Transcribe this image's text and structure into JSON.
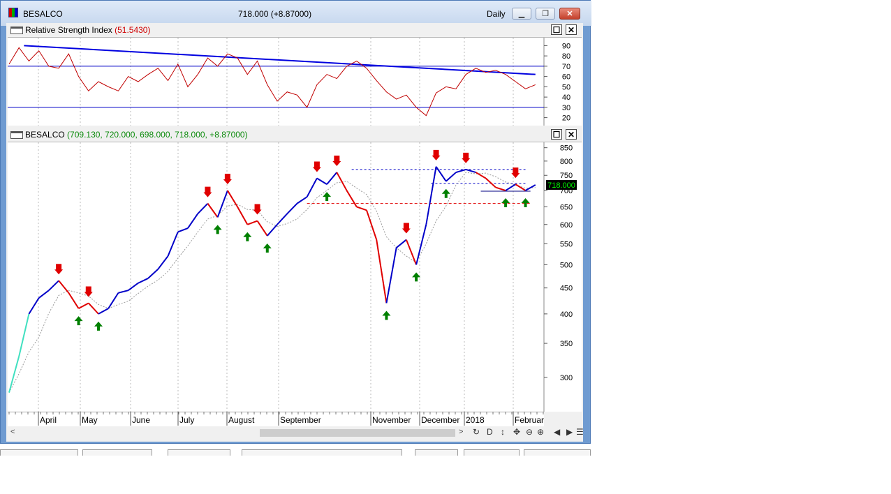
{
  "window": {
    "title": "BESALCO",
    "quote": "718.000 (+8.87000)",
    "period": "Daily",
    "minimize_label": "▁",
    "restore_label": "❐",
    "close_label": "✕"
  },
  "rsi_pane": {
    "title": "Relative Strength Index",
    "value_label": "(51.5430)",
    "max_label": "☐",
    "close_label": "✕",
    "y_ticks": [
      "90",
      "80",
      "70",
      "60",
      "50",
      "40",
      "30",
      "20"
    ]
  },
  "price_pane": {
    "title": "BESALCO",
    "ohlc_label": "(709.130, 720.000, 698.000, 718.000, +8.87000)",
    "max_label": "☐",
    "close_label": "✕",
    "y_ticks": [
      "850",
      "800",
      "750",
      "700",
      "650",
      "600",
      "550",
      "500",
      "450",
      "400",
      "350",
      "300"
    ],
    "last_price_tag": "718.000"
  },
  "x_axis": {
    "months": [
      "April",
      "May",
      "June",
      "July",
      "August",
      "September",
      "November",
      "December",
      "2018",
      "Februar"
    ]
  },
  "colors": {
    "window_frame": "#6f9bd1",
    "chart_bg": "#ffffff",
    "rsi_line": "#c00000",
    "rsi_levels": "#0000c8",
    "trendline": "#0000e0",
    "price_up": "#0000c8",
    "price_down": "#e00000",
    "price_neutral": "#40e0c0",
    "buy_arrow": "#008000",
    "sell_arrow": "#e00000",
    "tag_bg": "#000000",
    "tag_fg": "#00ff00"
  },
  "chart_data": [
    {
      "type": "line",
      "series": [
        {
          "x": [
            0,
            4,
            8,
            12,
            16,
            20,
            24,
            28,
            32,
            36,
            40,
            44,
            48,
            52,
            56,
            60,
            64,
            68,
            72,
            76,
            80,
            84,
            88,
            92,
            96,
            100,
            104,
            108,
            112,
            116,
            120,
            124,
            128,
            132,
            136,
            140,
            144,
            148,
            152,
            156,
            160,
            164,
            168,
            172,
            176,
            180,
            184,
            188,
            192,
            196,
            200,
            204,
            208,
            212
          ],
          "values": [
            72,
            88,
            75,
            85,
            70,
            68,
            82,
            60,
            46,
            55,
            50,
            46,
            60,
            55,
            62,
            68,
            56,
            72,
            50,
            62,
            78,
            70,
            82,
            78,
            62,
            75,
            52,
            36,
            45,
            42,
            30,
            52,
            62,
            58,
            70,
            75,
            68,
            56,
            45,
            38,
            42,
            30,
            22,
            44,
            50,
            48,
            62,
            68,
            64,
            66,
            62,
            55,
            48,
            52
          ]
        }
      ],
      "levels": [
        70,
        30
      ],
      "ylim": [
        15,
        95
      ]
    },
    {
      "type": "line",
      "series": [
        {
          "x": [
            0,
            4,
            8,
            12,
            16,
            20,
            24,
            28,
            32,
            36,
            40,
            44,
            48,
            52,
            56,
            60,
            64,
            68,
            72,
            76,
            80,
            84,
            88,
            92,
            96,
            100,
            104,
            108,
            112,
            116,
            120,
            124,
            128,
            132,
            136,
            140,
            144,
            148,
            152,
            156,
            160,
            164,
            168,
            172,
            176,
            180,
            184,
            188,
            192,
            196,
            200,
            204,
            208,
            212
          ],
          "values": [
            280,
            330,
            400,
            430,
            445,
            465,
            440,
            410,
            420,
            400,
            410,
            440,
            445,
            460,
            470,
            490,
            520,
            580,
            590,
            630,
            660,
            620,
            700,
            650,
            600,
            610,
            570,
            600,
            630,
            660,
            680,
            740,
            720,
            760,
            700,
            650,
            640,
            560,
            420,
            540,
            560,
            500,
            600,
            780,
            730,
            760,
            770,
            760,
            740,
            710,
            700,
            720,
            700,
            718
          ]
        }
      ],
      "levels": [
        770,
        723,
        698,
        660
      ],
      "ylim": [
        260,
        860
      ]
    }
  ]
}
